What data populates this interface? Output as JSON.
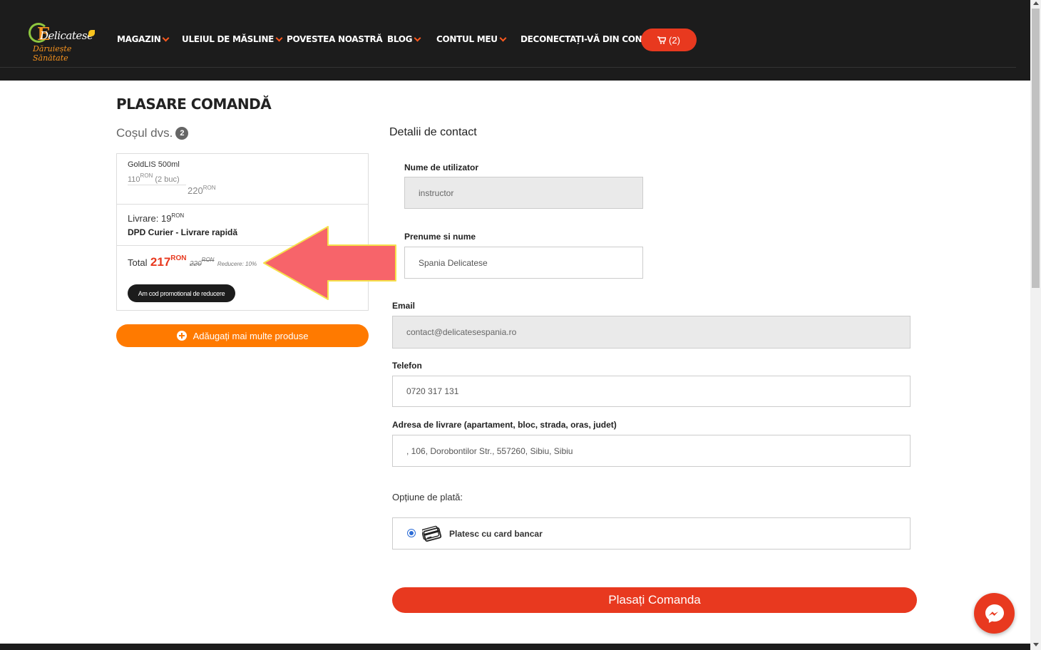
{
  "header": {
    "logo": {
      "brand": "Delicatese",
      "tagline": "Dăruiește Sănătate"
    },
    "nav": [
      {
        "label": "MAGAZIN",
        "has_dropdown": true
      },
      {
        "label": "ULEIUL DE MĂSLINE",
        "has_dropdown": true
      },
      {
        "label": "POVESTEA NOASTRĂ",
        "has_dropdown": false
      },
      {
        "label": "BLOG",
        "has_dropdown": true
      },
      {
        "label": "CONTUL MEU",
        "has_dropdown": true
      },
      {
        "label": "DECONECTAȚI-VĂ DIN CONT",
        "has_dropdown": false
      }
    ],
    "cart_label": "(2)"
  },
  "page_title": "PLASARE COMANDĂ",
  "cart": {
    "title": "Coșul dvs.",
    "count": "2",
    "product": {
      "name": "GoldLIS 500ml",
      "unit_price": "110",
      "currency": "RON",
      "quantity_text": "(2 buc)",
      "line_total": "220"
    },
    "shipping": {
      "label": "Livrare: 19",
      "currency": "RON",
      "method": "DPD Curier - Livrare rapidă"
    },
    "total": {
      "label": "Total",
      "value": "217",
      "currency": "RON",
      "old_value": "220",
      "old_currency": "RON",
      "discount": "Reducere: 10%"
    },
    "promo_button": "Am cod promotional de reducere",
    "add_more_button": "Adăugați mai multe produse"
  },
  "contact": {
    "title": "Detalii de contact",
    "username_label": "Nume de utilizator",
    "username_value": "instructor",
    "fullname_label": "Prenume si nume",
    "fullname_value": "Spania Delicatese",
    "email_label": "Email",
    "email_value": "contact@delicatesespania.ro",
    "phone_label": "Telefon",
    "phone_value": "0720 317 131",
    "address_label": "Adresa de livrare (apartament, bloc, strada, oras, judet)",
    "address_value": ", 106, Dorobontilor Str., 557260, Sibiu, Sibiu",
    "payment_label": "Opțiune de plată:",
    "payment_option": "Platesc cu card bancar",
    "submit_button": "Plasați Comanda"
  },
  "colors": {
    "header_bg": "#1c1c1c",
    "accent_red": "#e8391f",
    "accent_orange": "#ff7a00",
    "annotation_arrow": "#f7646a"
  },
  "icons": [
    "cart-icon",
    "plus-circle-icon",
    "credit-card-icon",
    "messenger-icon"
  ]
}
